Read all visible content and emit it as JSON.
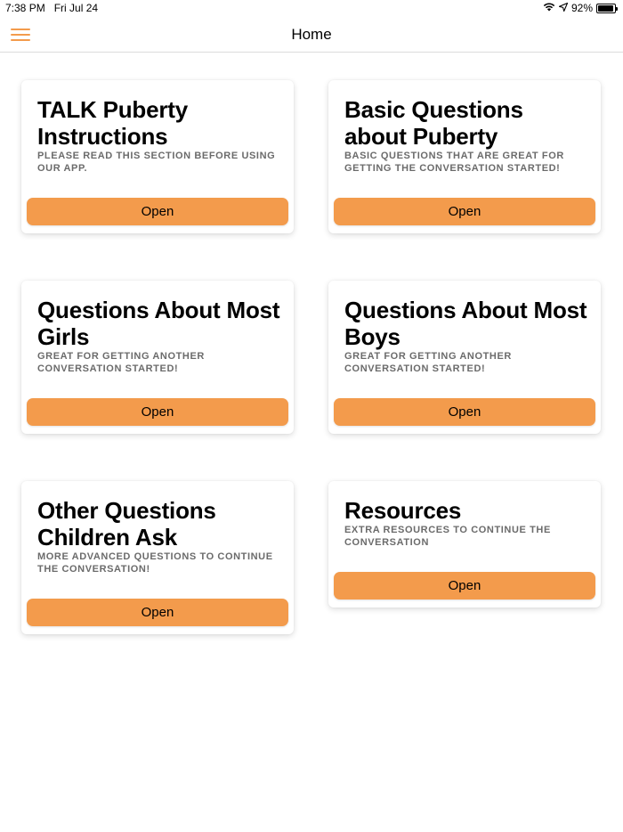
{
  "status_bar": {
    "time": "7:38 PM",
    "date": "Fri Jul 24",
    "battery": "92%",
    "battery_level": 0.92
  },
  "nav": {
    "title": "Home"
  },
  "colors": {
    "accent": "#f39b4c"
  },
  "cards": [
    {
      "title": "TALK Puberty Instructions",
      "subtitle": "PLEASE READ THIS SECTION BEFORE USING OUR APP.",
      "button": "Open"
    },
    {
      "title": "Basic Questions about Puberty",
      "subtitle": "BASIC QUESTIONS THAT ARE GREAT FOR GETTING THE CONVERSATION STARTED!",
      "button": "Open"
    },
    {
      "title": "Questions About Most Girls",
      "subtitle": "GREAT FOR GETTING ANOTHER CONVERSATION STARTED!",
      "button": "Open"
    },
    {
      "title": "Questions About Most Boys",
      "subtitle": "GREAT FOR GETTING ANOTHER CONVERSATION STARTED!",
      "button": "Open"
    },
    {
      "title": "Other Questions Children Ask",
      "subtitle": "MORE ADVANCED QUESTIONS TO CONTINUE THE CONVERSATION!",
      "button": "Open"
    },
    {
      "title": "Resources",
      "subtitle": "EXTRA RESOURCES TO CONTINUE THE CONVERSATION",
      "button": "Open"
    }
  ]
}
